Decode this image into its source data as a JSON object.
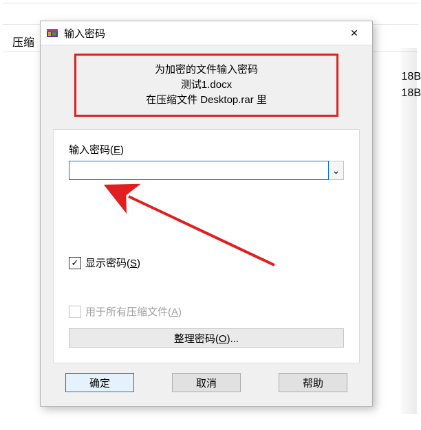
{
  "background": {
    "leftText": "压缩",
    "rightLine1": "18B",
    "rightLine2": "18B"
  },
  "dialog": {
    "title": "输入密码",
    "closeGlyph": "✕"
  },
  "message": {
    "line1": "为加密的文件输入密码",
    "line2": "测试1.docx",
    "line3_prefix": "在压缩文件 ",
    "line3_name": "Desktop.rar",
    "line3_suffix": " 里"
  },
  "password": {
    "label_prefix": "输入密码(",
    "label_hotkey": "E",
    "label_suffix": ")",
    "value": "",
    "dropdownGlyph": "⌄"
  },
  "showPassword": {
    "checked": true,
    "label_prefix": "显示密码(",
    "label_hotkey": "S",
    "label_suffix": ")"
  },
  "forAll": {
    "checked": false,
    "enabled": false,
    "label_prefix": "用于所有压缩文件(",
    "label_hotkey": "A",
    "label_suffix": ")"
  },
  "organize": {
    "label_prefix": "整理密码(",
    "label_hotkey": "O",
    "label_suffix": ")..."
  },
  "buttons": {
    "ok": "确定",
    "cancel": "取消",
    "help": "帮助"
  }
}
